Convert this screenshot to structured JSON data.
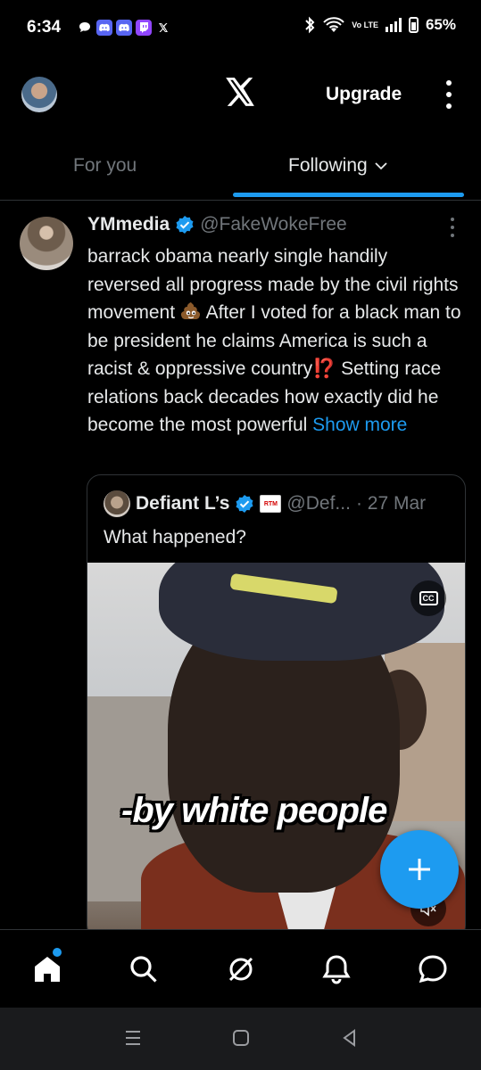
{
  "status_bar": {
    "time": "6:34",
    "battery_percent": "65%",
    "network": "Vo LTE",
    "notification_icons": [
      "chat-bubble-icon",
      "discord-icon",
      "discord-icon",
      "twitch-icon",
      "x-icon"
    ]
  },
  "header": {
    "upgrade_label": "Upgrade",
    "logo": "x-logo"
  },
  "tabs": {
    "for_you": "For you",
    "following": "Following",
    "active": "Following"
  },
  "tweet": {
    "name": "YMmedia",
    "handle": "@FakeWokeFree",
    "text_1": "barrack obama nearly single handily reversed all progress made by the civil rights movement",
    "text_2": "After I voted for a black man to be president he claims America is such a racist & oppressive country",
    "text_3": "Setting race relations back decades how exactly did he become the most powerful",
    "emoji_1": "pile-of-poo",
    "emoji_2": "⁉️",
    "show_more": "Show more",
    "quote": {
      "name": "Defiant L’s",
      "badge": "RTM",
      "handle": "@Def...",
      "date": "· 27 Mar",
      "text": "What happened?",
      "video_caption": "-by white people",
      "cc_label": "CC"
    }
  },
  "colors": {
    "accent": "#1d9bf0",
    "background": "#000000",
    "muted_text": "#71767b",
    "primary_text": "#e7e9ea"
  },
  "bottom_nav": [
    "home-icon",
    "search-icon",
    "grok-icon",
    "notifications-icon",
    "messages-icon"
  ]
}
